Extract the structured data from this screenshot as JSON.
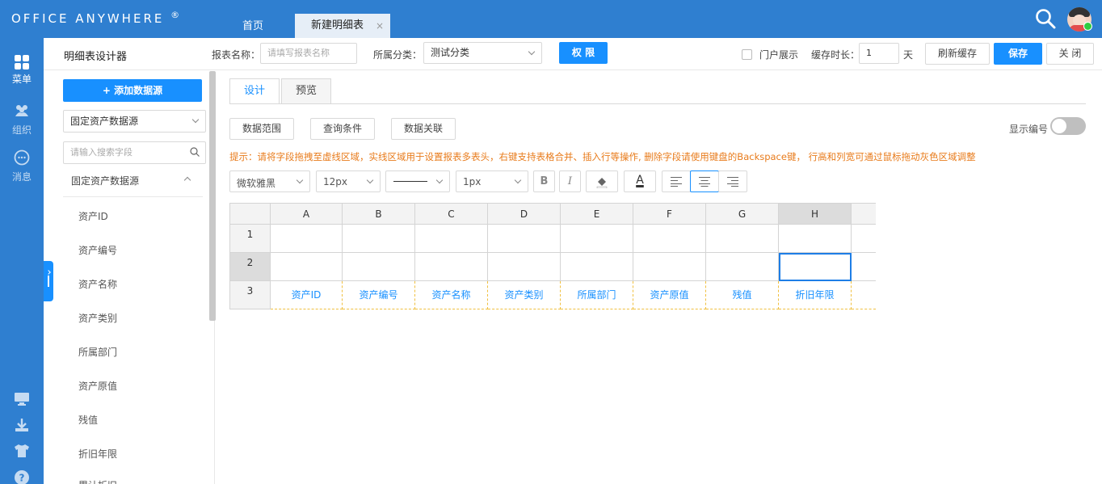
{
  "app": {
    "logo": "Office Anywhere",
    "logo_mark": "®",
    "tabs": [
      {
        "label": "首页"
      },
      {
        "label": "新建明细表",
        "close": "×"
      }
    ],
    "icons": {
      "search": "search-icon",
      "avatar": "avatar"
    }
  },
  "nav": {
    "items": [
      {
        "label": "菜单",
        "icon": "grid-icon"
      },
      {
        "label": "组织",
        "icon": "users-icon"
      },
      {
        "label": "消息",
        "icon": "chat-icon"
      }
    ],
    "bottom_icons": [
      "monitor-icon",
      "download-icon",
      "shirt-icon",
      "help-icon"
    ]
  },
  "toolbar": {
    "title": "明细表设计器",
    "report_name_label": "报表名称：",
    "report_name_placeholder": "请填写报表名称",
    "category_label": "所属分类：",
    "category_value": "测试分类",
    "permission_button": "权 限",
    "portal_label": "门户展示",
    "cache_label": "缓存时长：",
    "cache_value": "1",
    "cache_unit": "天",
    "refresh_button": "刷新缓存",
    "save_button": "保存",
    "close_button": "关 闭"
  },
  "left_panel": {
    "add_button": "+ 添加数据源",
    "source_select": "固定资产数据源",
    "search_placeholder": "请输入搜索字段",
    "group_title": "固定资产数据源",
    "fields": [
      "资产ID",
      "资产编号",
      "资产名称",
      "资产类别",
      "所属部门",
      "资产原值",
      "残值",
      "折旧年限",
      "累计折旧"
    ]
  },
  "designer": {
    "tabs": [
      "设计",
      "预览"
    ],
    "sub_buttons": [
      "数据范围",
      "查询条件",
      "数据关联"
    ],
    "show_number_label": "显示编号",
    "hint": "提示：请将字段拖拽至虚线区域，实线区域用于设置报表多表头，右键支持表格合并、插入行等操作, 删除字段请使用键盘的Backspace键， 行高和列宽可通过鼠标拖动灰色区域调整",
    "format": {
      "font": "微软雅黑",
      "font_size": "12px",
      "border_width": "1px",
      "bold": "B",
      "italic": "I",
      "font_color_glyph": "A"
    }
  },
  "grid": {
    "columns": [
      "A",
      "B",
      "C",
      "D",
      "E",
      "F",
      "G",
      "H"
    ],
    "rows": [
      "1",
      "2",
      "3"
    ],
    "row3_fields": [
      "资产ID",
      "资产编号",
      "资产名称",
      "资产类别",
      "所属部门",
      "资产原值",
      "残值",
      "折旧年限"
    ]
  }
}
